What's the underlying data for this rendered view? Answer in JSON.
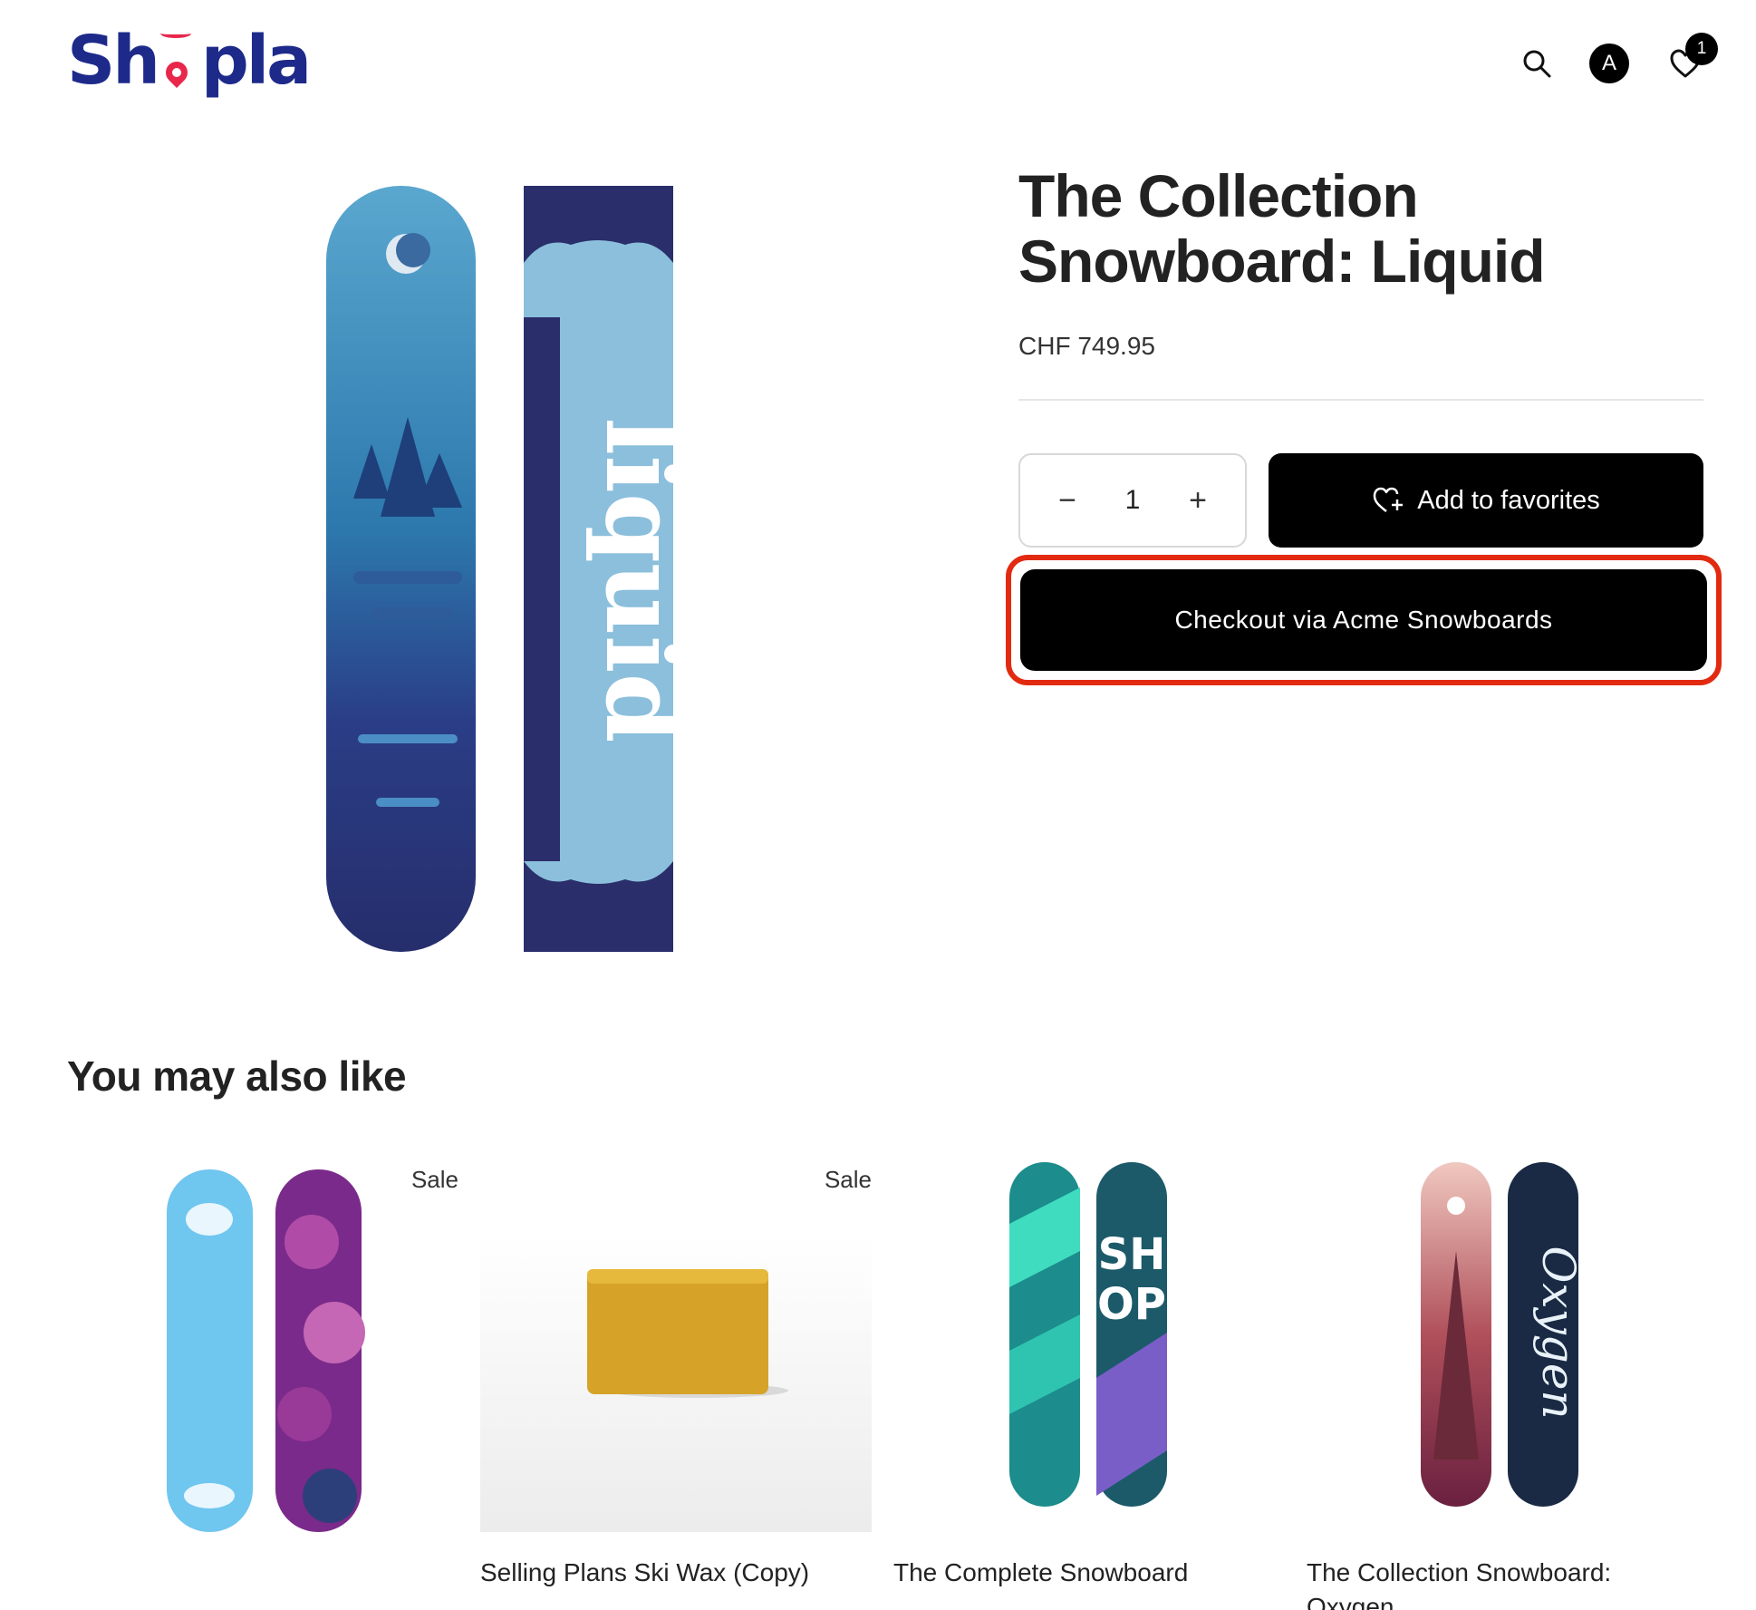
{
  "header": {
    "logo_text_pre": "Sh",
    "logo_text_o": "o",
    "logo_text_post": "pla",
    "account_initial": "A",
    "favorites_count": "1",
    "icons": [
      "search-icon",
      "account-icon",
      "heart-icon"
    ]
  },
  "product": {
    "title": "The Collection Snowboard: Liquid",
    "price": "CHF 749.95",
    "quantity": "1",
    "decrease_label": "−",
    "increase_label": "+",
    "add_to_favorites_label": "Add to favorites",
    "checkout_label": "Checkout via Acme Snowboards",
    "board_text": "liquid"
  },
  "recommendations": {
    "heading": "You may also like",
    "items": [
      {
        "title": "",
        "badge": "Sale"
      },
      {
        "title": "Selling Plans Ski Wax (Copy)",
        "badge": "Sale"
      },
      {
        "title": "The Complete Snowboard",
        "badge": ""
      },
      {
        "title": "The Collection Snowboard: Oxygen",
        "badge": ""
      }
    ]
  },
  "colors": {
    "brand": "#1d2a8a",
    "logo_pin": "#e8274b",
    "primary_button": "#000000",
    "highlight": "#e12a10"
  }
}
